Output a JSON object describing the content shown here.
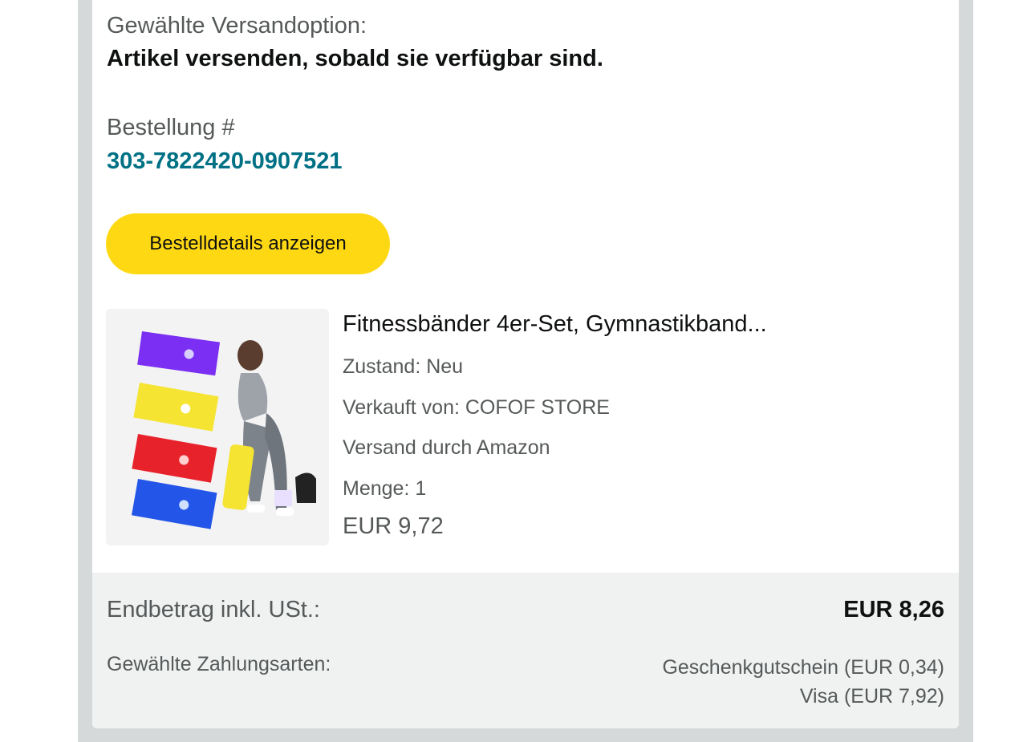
{
  "shipping": {
    "label": "Gewählte Versandoption:",
    "value": "Artikel versenden, sobald sie verfügbar sind."
  },
  "order": {
    "label": "Bestellung #",
    "number": "303-7822420-0907521",
    "details_button": "Bestelldetails anzeigen"
  },
  "item": {
    "title": "Fitnessbänder 4er-Set, Gymnastikband...",
    "condition": "Zustand: Neu",
    "seller": "Verkauft von: COFOF STORE",
    "fulfillment": "Versand durch Amazon",
    "quantity": "Menge: 1",
    "price": "EUR 9,72",
    "image_colors": [
      "#7b2ff2",
      "#f5e431",
      "#e8222b",
      "#2356e8"
    ]
  },
  "summary": {
    "total_label": "Endbetrag inkl. USt.:",
    "total_value": "EUR 8,26",
    "payment_label": "Gewählte Zahlungsarten:",
    "payments": [
      "Geschenkgutschein (EUR 0,34)",
      "Visa (EUR 7,92)"
    ]
  },
  "colors": {
    "link": "#007185",
    "button": "#ffd814",
    "summary_bg": "#f0f2f2"
  }
}
